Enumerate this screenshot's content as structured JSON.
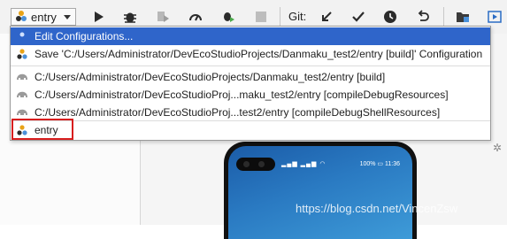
{
  "toolbar": {
    "run_config_label": "entry",
    "git_label": "Git:"
  },
  "dropdown": {
    "items": [
      {
        "label": "Edit Configurations..."
      },
      {
        "label": "Save 'C:/Users/Administrator/DevEcoStudioProjects/Danmaku_test2/entry [build]' Configuration"
      },
      {
        "label": "C:/Users/Administrator/DevEcoStudioProjects/Danmaku_test2/entry [build]"
      },
      {
        "label": "C:/Users/Administrator/DevEcoStudioProj...maku_test2/entry [compileDebugResources]"
      },
      {
        "label": "C:/Users/Administrator/DevEcoStudioProj...test2/entry [compileDebugShellResources]"
      },
      {
        "label": "entry"
      }
    ]
  },
  "device": {
    "battery": "100%",
    "time": "11:36"
  },
  "watermark": "https://blog.csdn.net/VincenZsw",
  "colors": {
    "selection": "#2f65ca",
    "highlight_border": "#d81e1e"
  }
}
